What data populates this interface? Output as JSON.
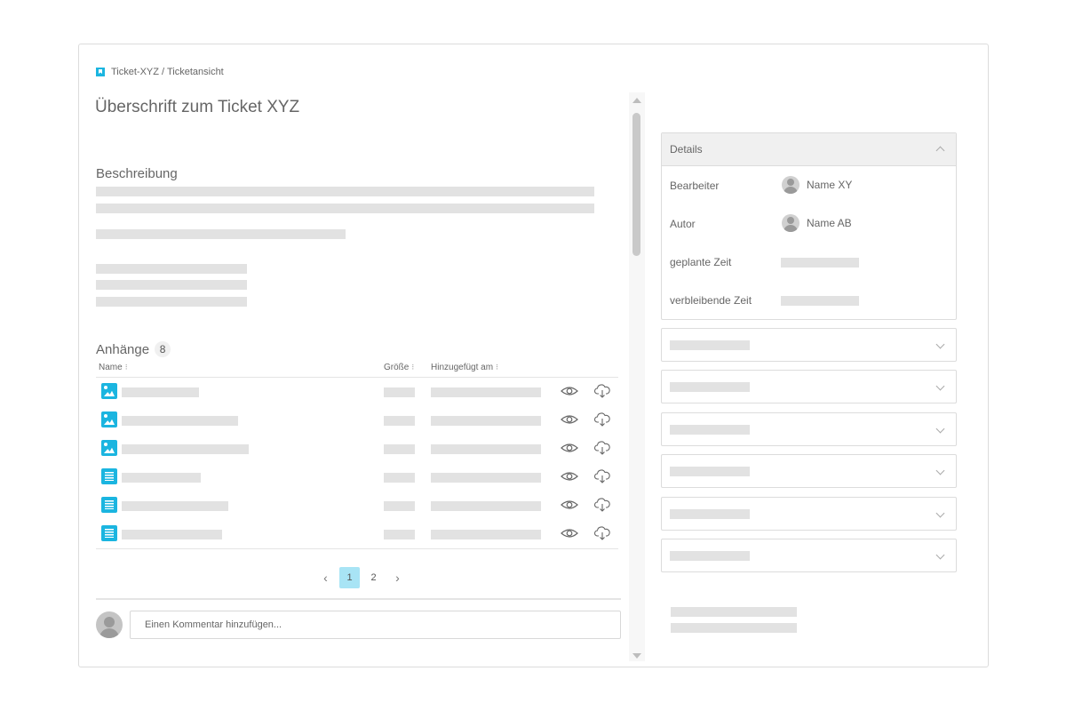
{
  "breadcrumb": {
    "text": "Ticket-XYZ / Ticketansicht",
    "icon": "bookmark-icon"
  },
  "ticket": {
    "title": "Überschrift zum Ticket XYZ"
  },
  "description": {
    "heading": "Beschreibung"
  },
  "attachments": {
    "heading": "Anhänge",
    "count": "8",
    "columns": {
      "name": "Name",
      "size": "Größe",
      "added": "Hinzugefügt am"
    },
    "rows": [
      {
        "type": "image"
      },
      {
        "type": "image"
      },
      {
        "type": "image"
      },
      {
        "type": "document"
      },
      {
        "type": "document"
      },
      {
        "type": "document"
      }
    ]
  },
  "pagination": {
    "pages": [
      "1",
      "2"
    ],
    "current": "1"
  },
  "comment": {
    "placeholder": "Einen Kommentar hinzufügen..."
  },
  "details": {
    "header": "Details",
    "fields": [
      {
        "label": "Bearbeiter",
        "value": "Name XY"
      },
      {
        "label": "Autor",
        "value": "Name AB"
      },
      {
        "label": "geplante Zeit",
        "value": ""
      },
      {
        "label": "verbleibende Zeit",
        "value": ""
      }
    ]
  },
  "colors": {
    "accent": "#1bb5e0",
    "active_page": "#a8e4f5",
    "placeholder": "#e2e2e2"
  }
}
